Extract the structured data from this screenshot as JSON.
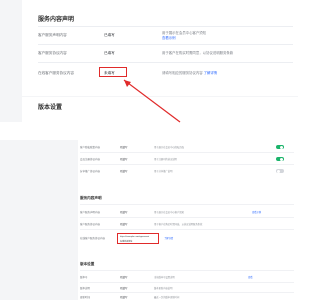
{
  "colors": {
    "accent": "#2f6bff",
    "highlight": "#e02a2a",
    "toggle_on": "#1bb46b",
    "toggle_off": "#d3d6db"
  },
  "top": {
    "section_title": "服务内容声明",
    "rows": [
      {
        "label": "客户服务声明内容",
        "value": "已填写",
        "desc": "用于展示在会员中心客户须知",
        "link": "查看示例"
      },
      {
        "label": "客户服务协议内容",
        "value": "已填写",
        "desc": "用于客户在购买时需同意，以协议说明服务条款"
      },
      {
        "label": "在线客户服务协议内容",
        "value": "未填写",
        "desc": "请填写相应的服务协议内容",
        "link": "了解详情"
      }
    ],
    "section2_title": "版本设置"
  },
  "bottom": {
    "top_rows": [
      {
        "label": "客户隐私政策内容",
        "value": "已填写",
        "desc": "用于展示在会员中心隐私页面",
        "toggle": "on"
      },
      {
        "label": "会员注册协议内容",
        "value": "已填写",
        "desc": "用于注册时的协议说明",
        "toggle": "on"
      },
      {
        "label": "分享推广协议内容",
        "value": "已填写",
        "desc": "用于分享推广说明",
        "toggle": "off"
      }
    ],
    "section_title": "服务内容声明",
    "mid_rows": [
      {
        "label": "客户服务声明内容",
        "value": "已填写",
        "desc": "用于展示在会员中心客户须知",
        "link": "查看示例"
      },
      {
        "label": "客户服务协议内容",
        "value": "已填写",
        "desc": "用于客户在购买时需同意，以协议说明服务条款"
      },
      {
        "label": "在线客户服务协议内容",
        "input_line1": "https://example.com/agreement",
        "input_line2": "在线协议地址",
        "link": "了解详情"
      }
    ],
    "section2_title": "版本设置",
    "version_rows": [
      {
        "label": "版本号",
        "value": "已填写",
        "desc": "当前版本号设置说明",
        "link": "查看"
      },
      {
        "label": "版本说明",
        "value": "已填写",
        "desc": "版本更新内容说明"
      },
      {
        "label": "更新时间",
        "value": "已填写",
        "desc": "最近一次的版本更新时间"
      }
    ]
  }
}
